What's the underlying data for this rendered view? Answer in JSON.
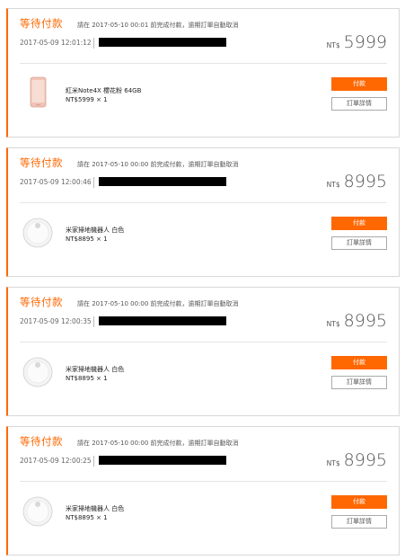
{
  "orders": [
    {
      "status": "等待付款",
      "notice": "請在 2017-05-10 00:01 前完成付款，逾期訂單自動取消",
      "datetime": "2017-05-09 12:01:12",
      "currency": "NT$",
      "amount": "5999",
      "product_name": "紅米Note4X 櫻花粉 64GB",
      "product_qty": "NT$5999 × 1",
      "product_icon": "phone-icon",
      "pay_label": "付款",
      "detail_label": "訂單詳情"
    },
    {
      "status": "等待付款",
      "notice": "請在 2017-05-10 00:00 前完成付款，逾期訂單自動取消",
      "datetime": "2017-05-09 12:00:46",
      "currency": "NT$",
      "amount": "8995",
      "product_name": "米家掃地機器人 白色",
      "product_qty": "NT$8895 × 1",
      "product_icon": "robot-vacuum-icon",
      "pay_label": "付款",
      "detail_label": "訂單詳情"
    },
    {
      "status": "等待付款",
      "notice": "請在 2017-05-10 00:00 前完成付款，逾期訂單自動取消",
      "datetime": "2017-05-09 12:00:35",
      "currency": "NT$",
      "amount": "8995",
      "product_name": "米家掃地機器人 白色",
      "product_qty": "NT$8895 × 1",
      "product_icon": "robot-vacuum-icon",
      "pay_label": "付款",
      "detail_label": "訂單詳情"
    },
    {
      "status": "等待付款",
      "notice": "請在 2017-05-10 00:00 前完成付款，逾期訂單自動取消",
      "datetime": "2017-05-09 12:00:25",
      "currency": "NT$",
      "amount": "8995",
      "product_name": "米家掃地機器人 白色",
      "product_qty": "NT$8895 × 1",
      "product_icon": "robot-vacuum-icon",
      "pay_label": "付款",
      "detail_label": "訂單詳情"
    }
  ],
  "colors": {
    "accent": "#ff6700",
    "redaction": "#000000"
  }
}
